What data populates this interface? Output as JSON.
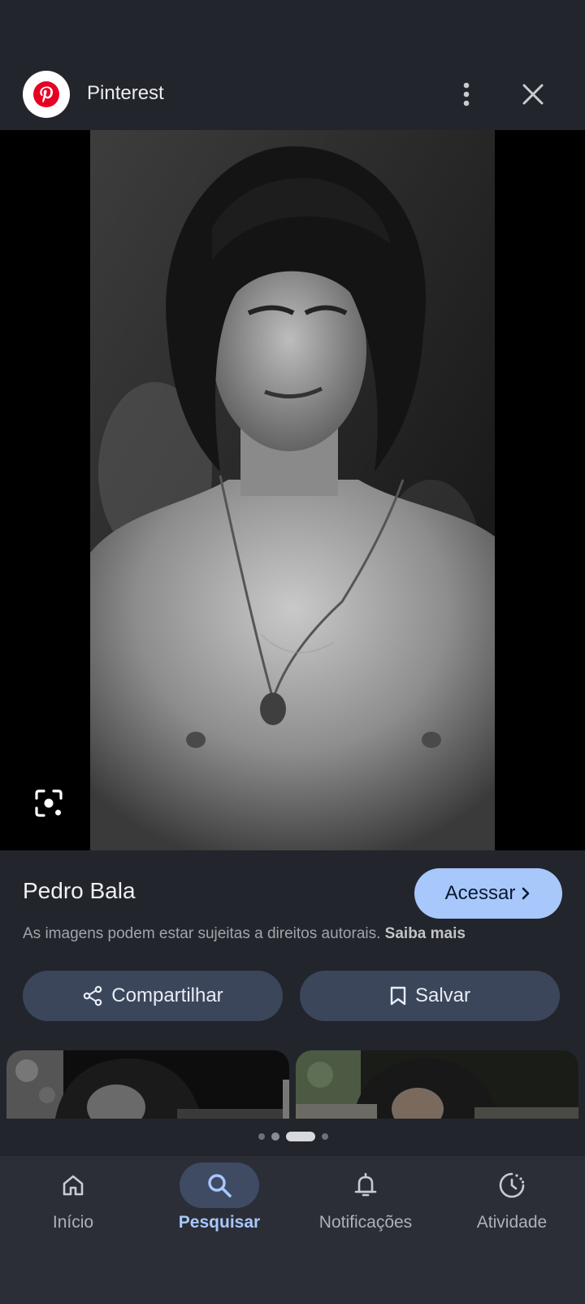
{
  "header": {
    "site_name": "Pinterest",
    "logo_icon": "pinterest-logo",
    "more_icon": "more-vert-icon",
    "close_icon": "close-icon"
  },
  "viewer": {
    "lens_icon": "lens-icon"
  },
  "result": {
    "title": "Pedro Bala",
    "visit_label": "Acessar",
    "copyright_text": "As imagens podem estar sujeitas a direitos autorais.",
    "copyright_link": "Saiba mais"
  },
  "actions": {
    "share_label": "Compartilhar",
    "save_label": "Salvar"
  },
  "nav": [
    {
      "label": "Início",
      "icon": "home-icon",
      "active": false
    },
    {
      "label": "Pesquisar",
      "icon": "search-icon",
      "active": true
    },
    {
      "label": "Notificações",
      "icon": "bell-icon",
      "active": false
    },
    {
      "label": "Atividade",
      "icon": "activity-icon",
      "active": false
    }
  ],
  "colors": {
    "accent": "#a8c7fa",
    "background": "#23252c",
    "pinterest_red": "#e60023"
  }
}
